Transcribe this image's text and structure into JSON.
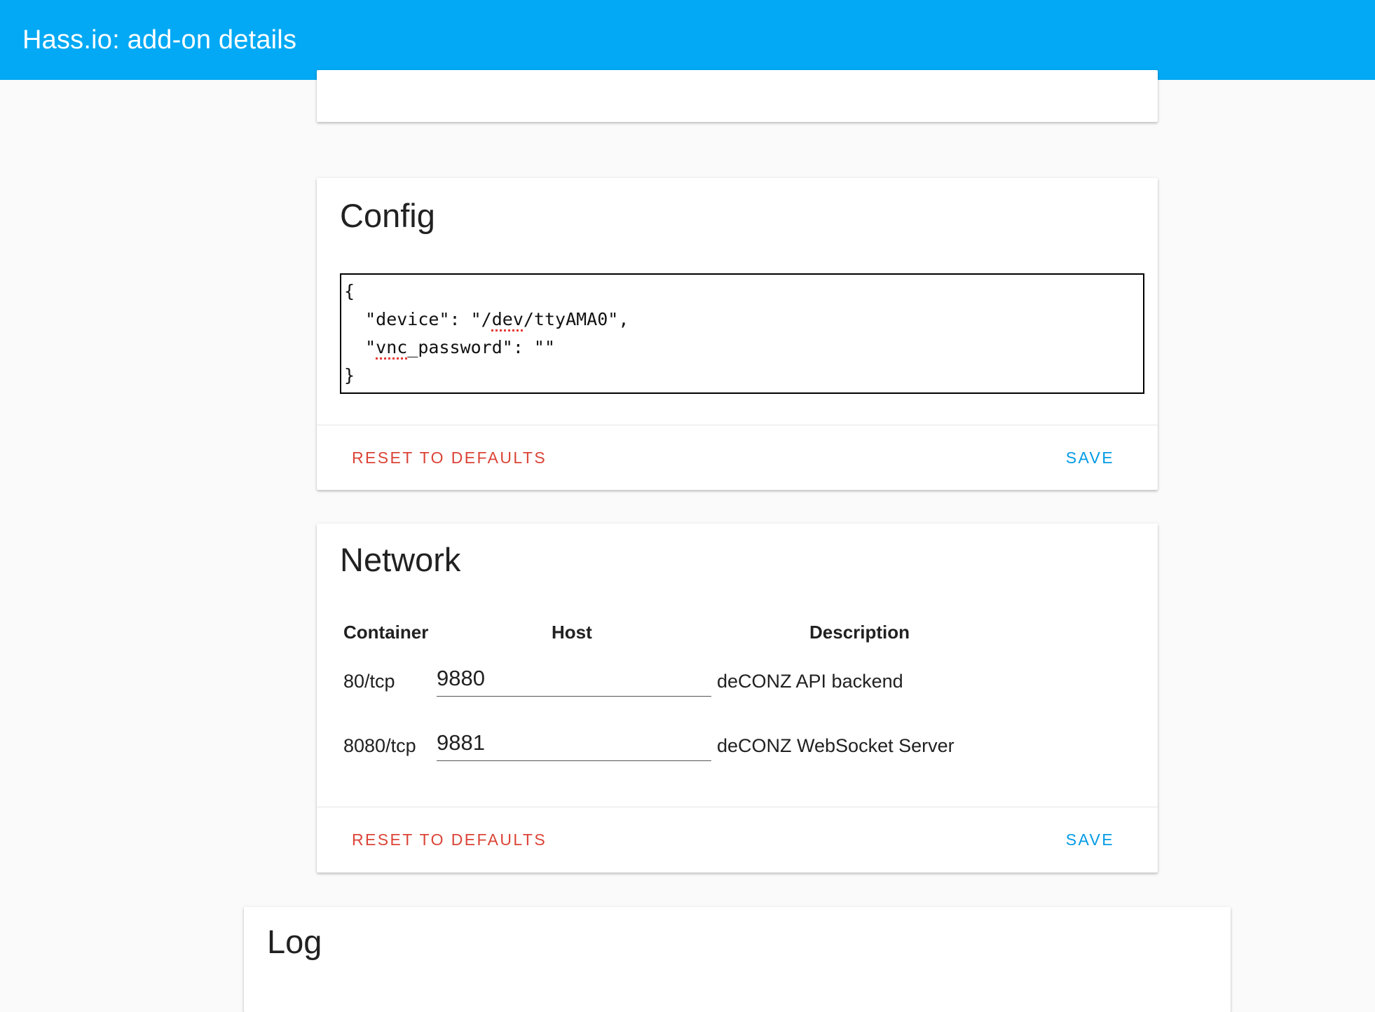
{
  "header": {
    "title": "Hass.io: add-on details",
    "color": "#03a9f4"
  },
  "config_card": {
    "title": "Config",
    "editor_lines": [
      "{",
      "  \"device\": \"/dev/ttyAMA0\",",
      "  \"vnc_password\": \"\"",
      "}"
    ],
    "reset_label": "RESET TO DEFAULTS",
    "save_label": "SAVE"
  },
  "network_card": {
    "title": "Network",
    "columns": [
      "Container",
      "Host",
      "Description"
    ],
    "rows": [
      {
        "container": "80/tcp",
        "host": "9880",
        "description": "deCONZ API backend"
      },
      {
        "container": "8080/tcp",
        "host": "9881",
        "description": "deCONZ WebSocket Server"
      }
    ],
    "reset_label": "RESET TO DEFAULTS",
    "save_label": "SAVE"
  },
  "log_card": {
    "title": "Log"
  },
  "colors": {
    "reset": "#db4437",
    "save": "#039be5",
    "background": "#fafafa"
  }
}
